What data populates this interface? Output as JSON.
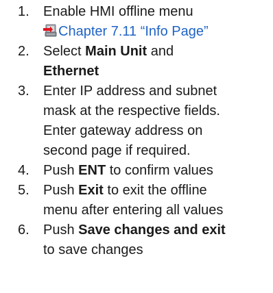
{
  "steps": [
    {
      "number": "1.",
      "line1": "Enable HMI offline menu",
      "link_text": "Chapter 7.11 “Info Page”",
      "link_icon": "book-reference-icon"
    },
    {
      "number": "2.",
      "pre": "Select ",
      "bold1": "Main Unit",
      "mid": " and",
      "bold2": "Ethernet"
    },
    {
      "number": "3.",
      "line1": "Enter IP address and subnet",
      "line2": "mask at the respective fields.",
      "line3": "Enter gateway address on",
      "line4": "second page if required."
    },
    {
      "number": "4.",
      "pre": "Push ",
      "bold": "ENT",
      "post": " to confirm values"
    },
    {
      "number": "5.",
      "pre": "Push ",
      "bold": "Exit",
      "post": " to exit the offline",
      "line2": "menu after entering all values"
    },
    {
      "number": "6.",
      "pre": "Push ",
      "bold": "Save changes and exit",
      "line2": "to save changes"
    }
  ],
  "colors": {
    "link": "#1f63c6",
    "text": "#1a1a1a"
  }
}
